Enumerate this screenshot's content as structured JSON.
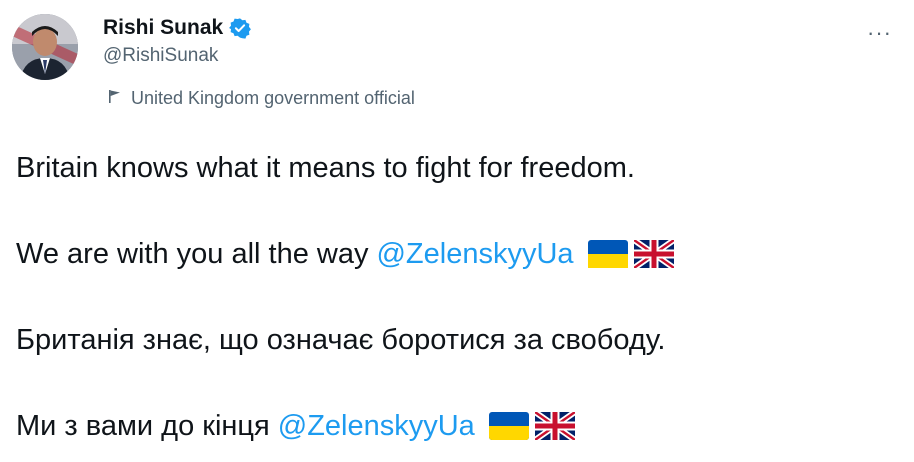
{
  "author": {
    "name": "Rishi Sunak",
    "handle": "@RishiSunak",
    "label": "United Kingdom government official"
  },
  "menu": {
    "more_label": "···"
  },
  "tweet": {
    "lines": [
      {
        "text": "Britain knows what it means to fight for freedom."
      },
      {
        "text": "We are with you all the way",
        "mention": "@ZelenskyyUa",
        "flags": [
          "ukraine-flag",
          "uk-flag"
        ]
      },
      {
        "text": "Британія знає, що означає боротися за свободу."
      },
      {
        "text": "Ми з вами до кінця",
        "mention": "@ZelenskyyUa",
        "flags": [
          "ukraine-flag",
          "uk-flag"
        ]
      }
    ]
  },
  "colors": {
    "text": "#0f1419",
    "secondary": "#536471",
    "link": "#1d9bf0",
    "verified": "#1d9bf0"
  }
}
